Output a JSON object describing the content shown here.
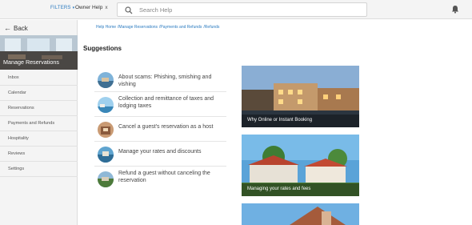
{
  "topbar": {
    "filters_label": "FILTERS",
    "owner_chip": "Owner Help",
    "owner_chip_close": "x",
    "search_placeholder": "Search Help"
  },
  "sidebar": {
    "back_label": "Back",
    "banner_title": "Manage Reservations",
    "items": [
      {
        "label": "Inbox"
      },
      {
        "label": "Calendar"
      },
      {
        "label": "Reservations"
      },
      {
        "label": "Payments and Refunds"
      },
      {
        "label": "Hospitality"
      },
      {
        "label": "Reviews"
      },
      {
        "label": "Settings"
      }
    ]
  },
  "breadcrumbs": [
    "Help Home",
    "/Manage Reservations",
    "/Payments and Refunds",
    "/Refunds"
  ],
  "suggestions": {
    "heading": "Suggestions",
    "items": [
      {
        "label": "About scams: Phishing, smishing and vishing"
      },
      {
        "label": "Collection and remittance of taxes and lodging taxes"
      },
      {
        "label": "Cancel a guest's reservation as a host"
      },
      {
        "label": "Manage your rates and discounts"
      },
      {
        "label": "Refund a guest without canceling the reservation"
      }
    ]
  },
  "cards": [
    {
      "caption": "Why Online or Instant Booking"
    },
    {
      "caption": "Managing your rates and fees"
    },
    {
      "caption": ""
    }
  ],
  "colors": {
    "link": "#2b7bc0",
    "sidebar_bg": "#f4f4f4"
  }
}
